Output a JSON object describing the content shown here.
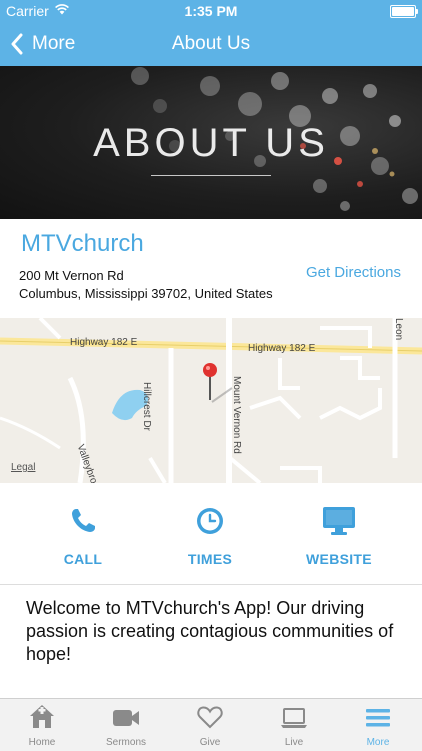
{
  "status": {
    "carrier": "Carrier",
    "time": "1:35 PM"
  },
  "nav": {
    "back_label": "More",
    "title": "About Us"
  },
  "hero": {
    "title": "ABOUT US"
  },
  "info": {
    "name": "MTVchurch",
    "address_line1": "200 Mt Vernon Rd",
    "address_line2": "Columbus, Mississippi 39702, United States",
    "directions_label": "Get Directions"
  },
  "map": {
    "legal_label": "Legal",
    "roads": [
      "Highway 182 E",
      "Highway 182 E",
      "Hillcrest Dr",
      "Mount Vernon Rd",
      "Valleybrook",
      "Leon"
    ]
  },
  "actions": [
    {
      "label": "CALL",
      "icon": "phone-icon"
    },
    {
      "label": "TIMES",
      "icon": "clock-icon"
    },
    {
      "label": "WEBSITE",
      "icon": "monitor-icon"
    }
  ],
  "welcome": "Welcome to MTVchurch's App! Our driving passion is creating contagious communities of hope!",
  "tabs": [
    {
      "label": "Home",
      "icon": "home-icon"
    },
    {
      "label": "Sermons",
      "icon": "video-camera-icon"
    },
    {
      "label": "Give",
      "icon": "heart-icon"
    },
    {
      "label": "Live",
      "icon": "laptop-icon"
    },
    {
      "label": "More",
      "icon": "menu-icon",
      "active": true
    }
  ],
  "colors": {
    "accent": "#5db3e6",
    "link": "#4aa8e0",
    "pin": "#e0322f"
  }
}
